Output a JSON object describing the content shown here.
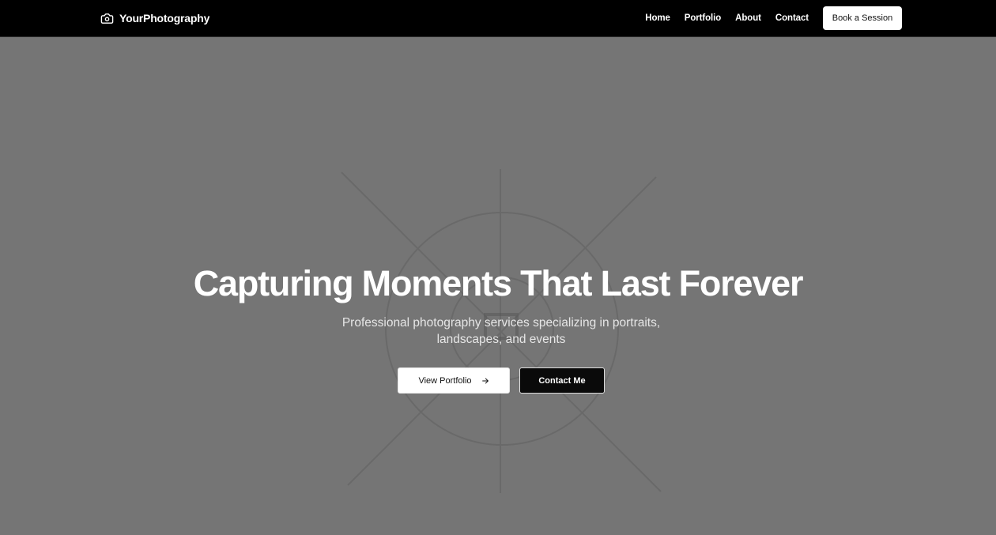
{
  "brand": {
    "name": "YourPhotography",
    "icon": "camera-icon"
  },
  "nav": {
    "links": [
      {
        "label": "Home"
      },
      {
        "label": "Portfolio"
      },
      {
        "label": "About"
      },
      {
        "label": "Contact"
      }
    ],
    "cta_label": "Book a Session"
  },
  "hero": {
    "title": "Capturing Moments That Last Forever",
    "subtitle": "Professional photography services specializing in portraits, landscapes, and events",
    "primary_button": {
      "label": "View Portfolio",
      "icon": "arrow-right-icon"
    },
    "secondary_button": {
      "label": "Contact Me"
    }
  },
  "colors": {
    "navbar_bg": "#000000",
    "hero_bg": "#757575",
    "primary_button_bg": "#ffffff",
    "secondary_button_bg": "#0a0a0a",
    "text_light": "#ffffff"
  }
}
